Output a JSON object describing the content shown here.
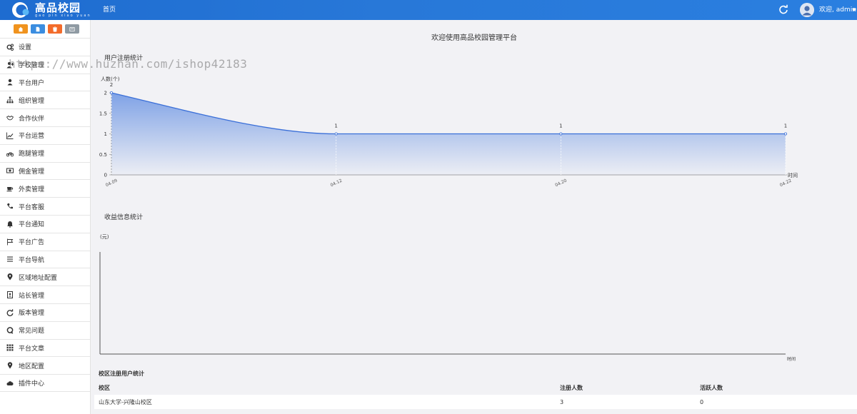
{
  "header": {
    "logo_title": "高品校园",
    "logo_subtitle": "gao pin xiao yuan",
    "nav_home": "首页",
    "user_greeting": "欢迎, admin"
  },
  "sidebar": {
    "quick_buttons": [
      {
        "icon": "home-icon",
        "color": "#f0931e"
      },
      {
        "icon": "document-icon",
        "color": "#3b8de0"
      },
      {
        "icon": "trash-icon",
        "color": "#f36b2a"
      },
      {
        "icon": "card-icon",
        "color": "#8f9aa3"
      }
    ],
    "items": [
      {
        "label": "设置",
        "icon": "gears-icon"
      },
      {
        "label": "学校管理",
        "icon": "user-plus-icon"
      },
      {
        "label": "平台用户",
        "icon": "user-icon"
      },
      {
        "label": "组织管理",
        "icon": "sitemap-icon"
      },
      {
        "label": "合作伙伴",
        "icon": "handshake-icon"
      },
      {
        "label": "平台运营",
        "icon": "line-chart-icon"
      },
      {
        "label": "跑腿管理",
        "icon": "motorcycle-icon"
      },
      {
        "label": "佣金管理",
        "icon": "money-icon"
      },
      {
        "label": "外卖管理",
        "icon": "coffee-icon"
      },
      {
        "label": "平台客服",
        "icon": "phone-icon"
      },
      {
        "label": "平台通知",
        "icon": "bell-icon"
      },
      {
        "label": "平台广告",
        "icon": "flag-icon"
      },
      {
        "label": "平台导航",
        "icon": "bars-icon"
      },
      {
        "label": "区域地址配置",
        "icon": "map-marker-icon"
      },
      {
        "label": "站长管理",
        "icon": "id-badge-icon"
      },
      {
        "label": "版本管理",
        "icon": "refresh-icon"
      },
      {
        "label": "常见问题",
        "icon": "question-icon"
      },
      {
        "label": "平台文章",
        "icon": "grid-icon"
      },
      {
        "label": "地区配置",
        "icon": "map-pin-icon"
      },
      {
        "label": "插件中心",
        "icon": "cloud-icon"
      }
    ]
  },
  "main": {
    "welcome": "欢迎使用高品校园管理平台",
    "user_chart_title": "用户注册统计",
    "income_chart_title": "收益信息统计",
    "table_title": "校区注册用户统计",
    "table_headers": [
      "校区",
      "注册人数",
      "活跃人数"
    ],
    "table_rows": [
      [
        "山东大学-兴隆山校区",
        "3",
        "0"
      ]
    ]
  },
  "watermark": "https://www.huzhan.com/ishop42183",
  "chart_data": [
    {
      "type": "area",
      "title": "用户注册统计",
      "xlabel": "时间",
      "ylabel": "人数(个)",
      "categories": [
        "04.09",
        "04.12",
        "04.20",
        "04.22"
      ],
      "values": [
        2,
        1,
        1,
        1
      ],
      "y_ticks": [
        "0",
        "0.5",
        "1",
        "1.5",
        "2"
      ],
      "ylim": [
        0,
        2
      ],
      "line_color": "#3a6fd8",
      "fill_top_color": "#7fa2e6"
    },
    {
      "type": "line",
      "title": "收益信息统计",
      "xlabel": "时间",
      "ylabel": "(元)",
      "categories": [],
      "values": []
    }
  ]
}
